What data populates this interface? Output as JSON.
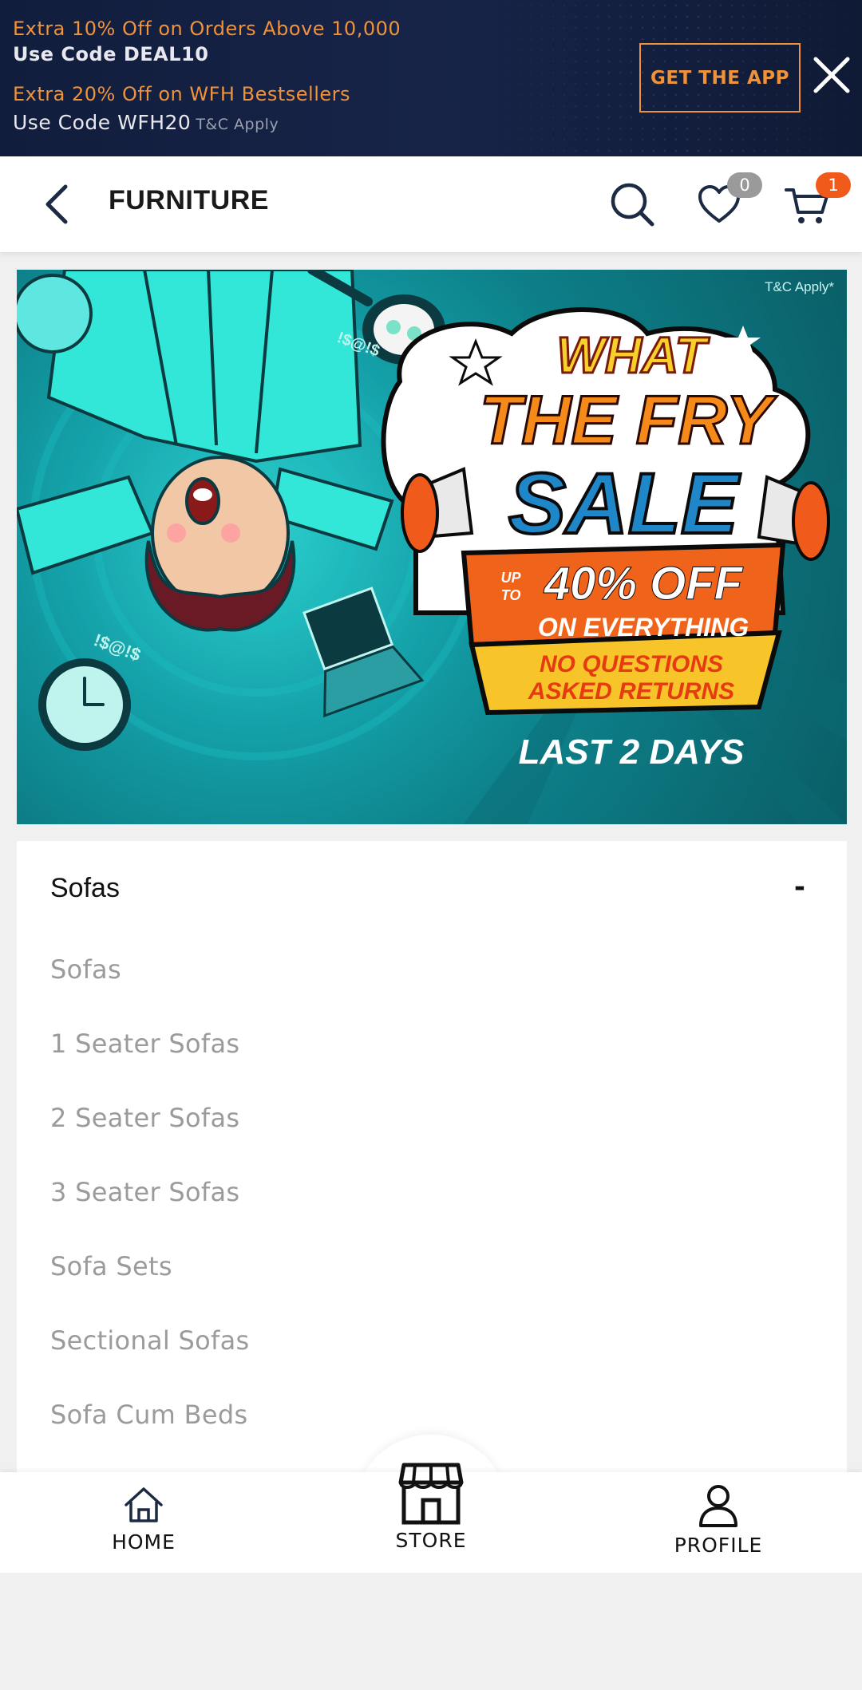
{
  "promo": {
    "line1": "Extra 10% Off on Orders Above 10,000",
    "line2": "Use Code DEAL10",
    "line3": "Extra 20% Off on WFH Bestsellers",
    "line4": "Use Code WFH20",
    "tc": "T&C Apply",
    "get_app": "GET THE APP",
    "accent": "#f0923a"
  },
  "header": {
    "title": "FURNITURE",
    "wishlist_count": "0",
    "cart_count": "1"
  },
  "hero": {
    "tc": "T&C Apply*",
    "line_what": "WHAT",
    "line_fry": "THE FRY",
    "line_sale": "SALE",
    "upto": "UPTO",
    "discount": "40% OFF",
    "on_everything": "ON EVERYTHING",
    "returns1": "NO QUESTIONS",
    "returns2": "ASKED RETURNS",
    "last_days": "LAST 2 DAYS"
  },
  "category": {
    "heading": "Sofas",
    "collapse_symbol": "-",
    "items": [
      "Sofas",
      "1 Seater Sofas",
      "2 Seater Sofas",
      "3 Seater Sofas",
      "Sofa Sets",
      "Sectional Sofas",
      "Sofa Cum Beds"
    ]
  },
  "nav": {
    "home": "HOME",
    "store": "STORE",
    "profile": "PROFILE"
  }
}
